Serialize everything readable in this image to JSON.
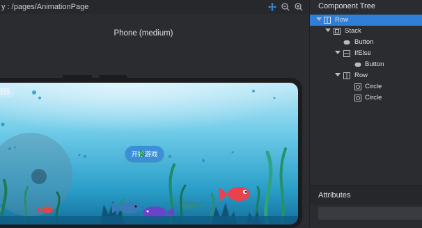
{
  "preview": {
    "path_text": "y : /pages/AnimationPage",
    "device_label": "Phone (medium)",
    "toolbar": {
      "move_icon": "move-icon",
      "zoom_out_icon": "zoom-out-icon",
      "zoom_in_icon": "zoom-in-icon"
    },
    "app": {
      "back_label": "返回",
      "start_label": "开始游戏"
    }
  },
  "component_tree": {
    "title": "Component Tree",
    "nodes": [
      {
        "label": "Row",
        "depth": 0,
        "expanded": true,
        "selected": true,
        "icon": "row-icon"
      },
      {
        "label": "Stack",
        "depth": 1,
        "expanded": true,
        "selected": false,
        "icon": "stack-icon"
      },
      {
        "label": "Button",
        "depth": 2,
        "expanded": false,
        "selected": false,
        "icon": "button-icon"
      },
      {
        "label": "IfElse",
        "depth": 2,
        "expanded": true,
        "selected": false,
        "icon": "ifelse-icon"
      },
      {
        "label": "Button",
        "depth": 3,
        "expanded": false,
        "selected": false,
        "icon": "button-icon"
      },
      {
        "label": "Row",
        "depth": 2,
        "expanded": true,
        "selected": false,
        "icon": "row-icon"
      },
      {
        "label": "Circle",
        "depth": 3,
        "expanded": false,
        "selected": false,
        "icon": "circle-icon"
      },
      {
        "label": "Circle",
        "depth": 3,
        "expanded": false,
        "selected": false,
        "icon": "circle-icon"
      }
    ]
  },
  "attributes": {
    "title": "Attributes"
  },
  "colors": {
    "accent": "#2f7fd8",
    "panel_bg": "#2b2c30",
    "text": "#dfe1e5"
  }
}
